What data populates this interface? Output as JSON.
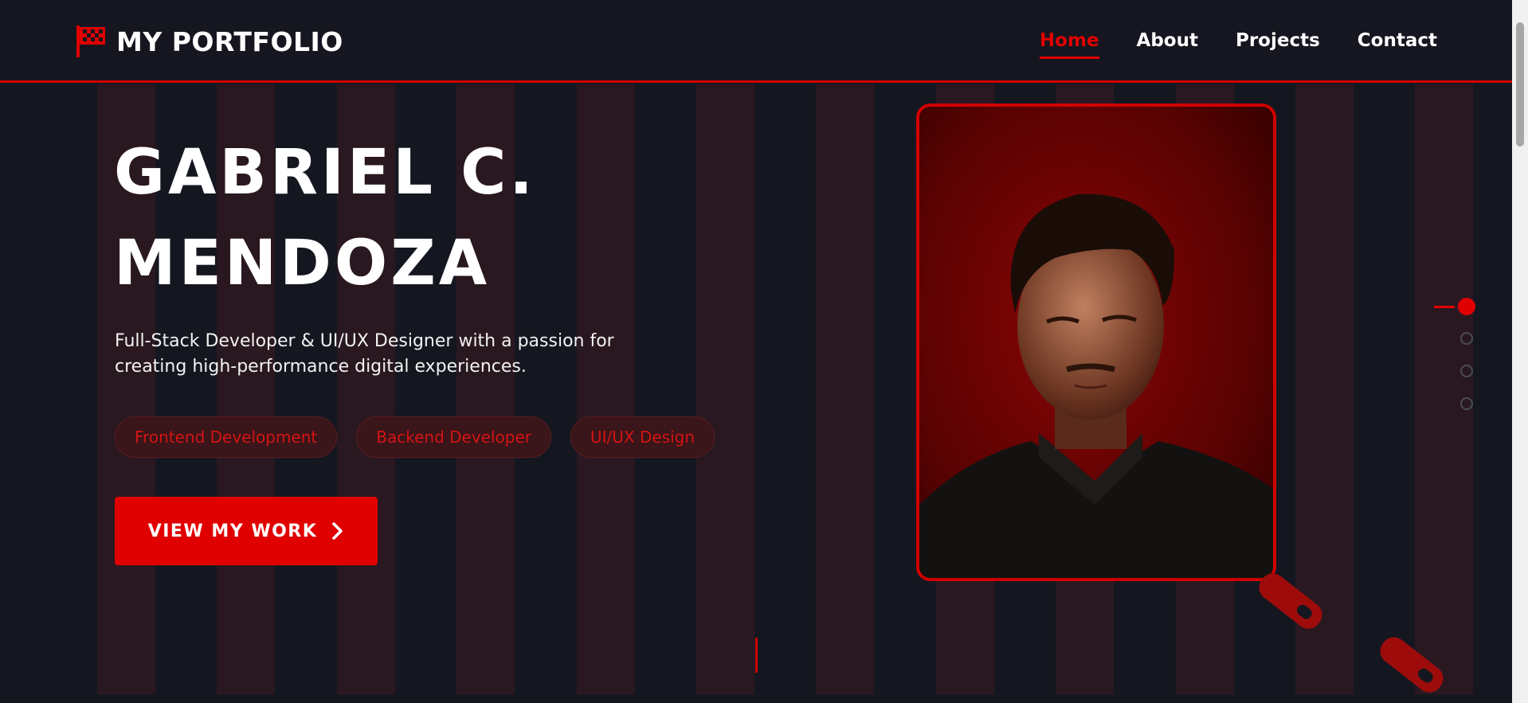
{
  "brand": {
    "name": "MY PORTFOLIO",
    "icon": "flag-icon",
    "accent_color": "#e00000"
  },
  "nav": {
    "links": [
      {
        "label": "Home",
        "active": true
      },
      {
        "label": "About",
        "active": false
      },
      {
        "label": "Projects",
        "active": false
      },
      {
        "label": "Contact",
        "active": false
      }
    ]
  },
  "hero": {
    "name_line1": "GABRIEL C.",
    "name_line2": "MENDOZA",
    "description": "Full-Stack Developer & UI/UX Designer with a passion for creating high-performance digital experiences.",
    "tags": [
      "Frontend Development",
      "Backend Developer",
      "UI/UX Design"
    ],
    "cta_label": "VIEW MY WORK",
    "cta_icon": "chevron-right-icon"
  },
  "photo": {
    "icon": "portrait-photo"
  },
  "section_indicator": {
    "count": 4,
    "active_index": 0
  }
}
